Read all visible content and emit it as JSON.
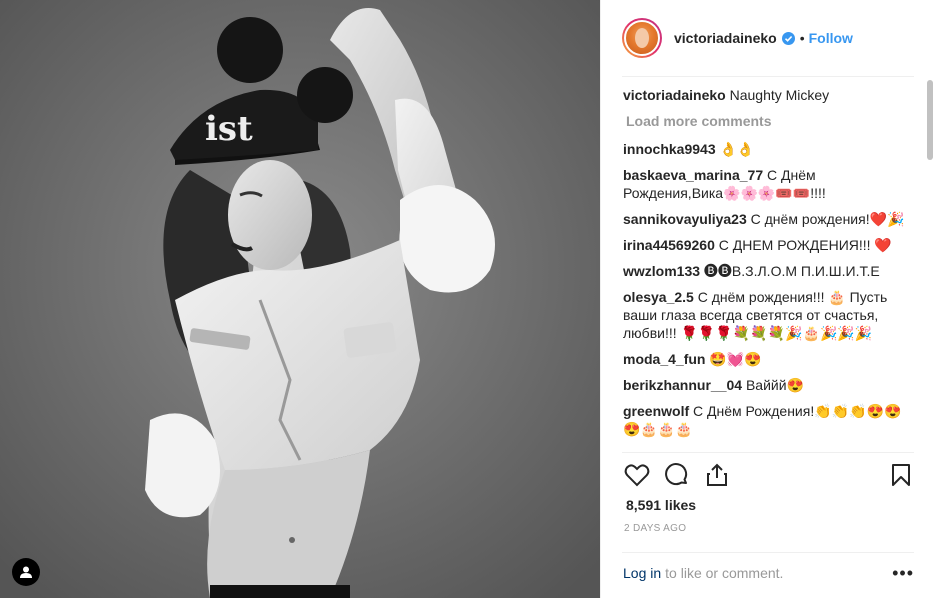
{
  "post": {
    "username": "victoriadaineko",
    "verified": true,
    "separator": "•",
    "follow_label": "Follow",
    "caption_author": "victoriadaineko",
    "caption_text": "Naughty Mickey",
    "load_more_label": "Load more comments",
    "cap_text": "ist",
    "comments": [
      {
        "author": "innochka9943",
        "text": "👌👌"
      },
      {
        "author": "baskaeva_marina_77",
        "text": "С Днём Рождения,Вика🌸🌸🌸🎟️🎟️!!!!"
      },
      {
        "author": "sannikovayuliya23",
        "text": "С днём рождения!❤️🎉"
      },
      {
        "author": "irina44569260",
        "text": "С ДНЕМ РОЖДЕНИЯ!!! ❤️"
      },
      {
        "author": "wwzlom133",
        "text": "🅑🅑В.З.Л.О.М П.И.Ш.И.Т.Е"
      },
      {
        "author": "olesya_2.5",
        "text": "С днём рождения!!! 🎂 Пусть ваши глаза всегда светятся от счастья, любви!!! 🌹🌹🌹💐💐💐🎉🎂🎉🎉🎉"
      },
      {
        "author": "moda_4_fun",
        "text": "🤩💓😍"
      },
      {
        "author": "berikzhannur__04",
        "text": "Ваййй😍"
      },
      {
        "author": "greenwolf",
        "text": "С Днём Рождения!👏👏👏😍😍😍🎂🎂🎂"
      }
    ],
    "likes": "8,591 likes",
    "time_ago": "2 DAYS AGO",
    "login_link": "Log in",
    "login_rest": "to like or comment.",
    "more_icon": "•••"
  },
  "colors": {
    "link": "#3897f0",
    "muted": "#999999",
    "text": "#262626",
    "divider": "#efefef"
  },
  "icons": [
    "user-tag-icon",
    "verified-badge-icon",
    "heart-icon",
    "comment-icon",
    "share-icon",
    "bookmark-icon",
    "more-options-icon"
  ]
}
